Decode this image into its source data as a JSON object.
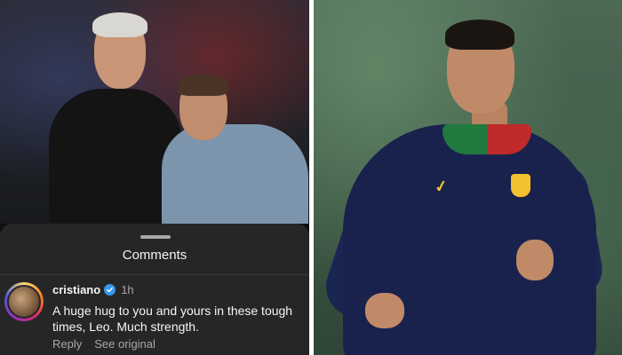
{
  "comments_sheet": {
    "title": "Comments",
    "comment": {
      "username": "cristiano",
      "timestamp": "1h",
      "text": "A huge hug to you and yours in these tough times, Leo. Much strength.",
      "reply_label": "Reply",
      "see_original_label": "See original"
    }
  },
  "colors": {
    "sheet_background": "#262626",
    "verified_badge": "#3797f0",
    "secondary_text": "#a8a8a8"
  },
  "icons": {
    "verified": "verified-badge-icon",
    "drag_handle": "drag-handle-icon"
  }
}
